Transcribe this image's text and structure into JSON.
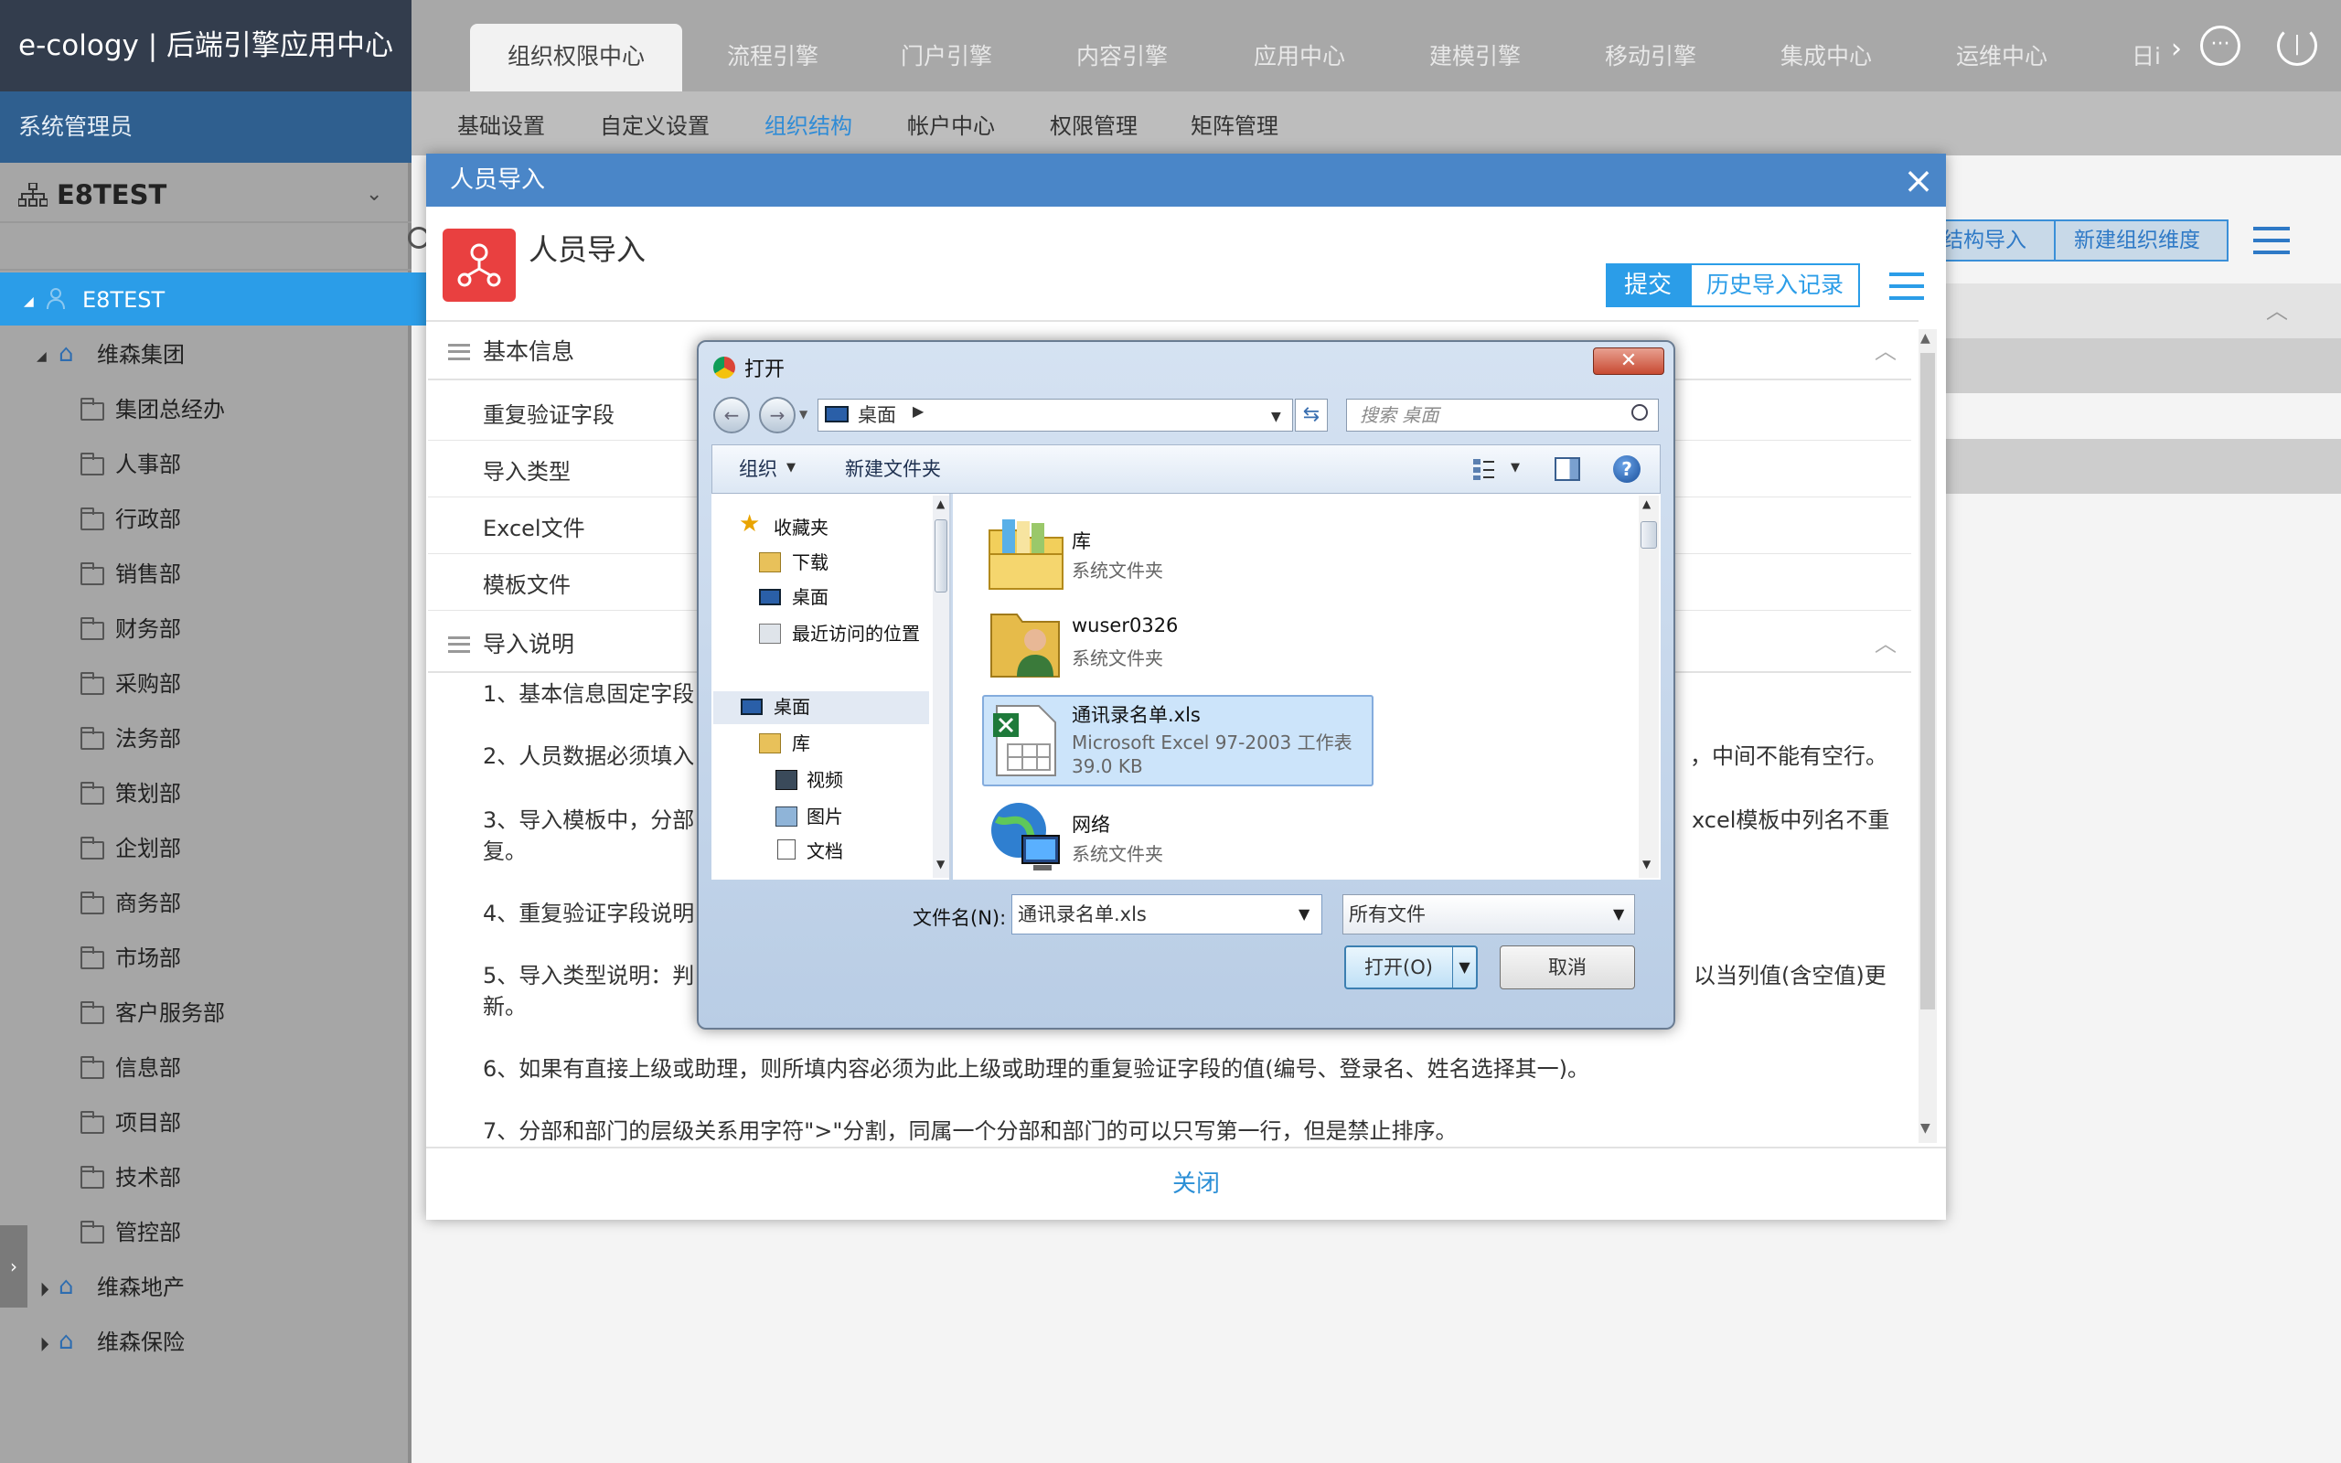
{
  "app": {
    "brand": "e-cology | 后端引擎应用中心"
  },
  "top_tabs": [
    "组织权限中心",
    "流程引擎",
    "门户引擎",
    "内容引擎",
    "应用中心",
    "建模引擎",
    "移动引擎",
    "集成中心",
    "运维中心",
    "日i"
  ],
  "sub_nav": [
    "基础设置",
    "自定义设置",
    "组织结构",
    "帐户中心",
    "权限管理",
    "矩阵管理"
  ],
  "sidebar": {
    "role": "系统管理员",
    "org": "E8TEST",
    "root": "E8TEST",
    "group": "维森集团",
    "departments": [
      "集团总经办",
      "人事部",
      "行政部",
      "销售部",
      "财务部",
      "采购部",
      "法务部",
      "策划部",
      "企划部",
      "商务部",
      "市场部",
      "客户服务部",
      "信息部",
      "项目部",
      "技术部",
      "管控部"
    ],
    "others": [
      "维森地产",
      "维森保险"
    ]
  },
  "background": {
    "btn1": "结构导入",
    "btn2": "新建组织维度"
  },
  "modal": {
    "title": "人员导入",
    "app_title": "人员导入",
    "submit": "提交",
    "history": "历史导入记录",
    "section_basic": "基本信息",
    "rows": [
      "重复验证字段",
      "导入类型",
      "Excel文件",
      "模板文件"
    ],
    "section_notes": "导入说明",
    "notes": [
      "1、基本信息固定字段",
      "2、人员数据必须填入",
      "，中间不能有空行。",
      "3、导入模板中，分部",
      "xcel模板中列名不重",
      "复。",
      "4、重复验证字段说明",
      "5、导入类型说明：判",
      "以当列值(含空值)更",
      "新。",
      "6、如果有直接上级或助理，则所填内容必须为此上级或助理的重复验证字段的值(编号、登录名、姓名选择其一)。",
      "7、分部和部门的层级关系用字符\">\"分割，同属一个分部和部门的可以只写第一行，但是禁止排序。"
    ],
    "close": "关闭"
  },
  "file_dialog": {
    "title": "打开",
    "address": "桌面",
    "search_placeholder": "搜索 桌面",
    "toolbar": {
      "organize": "组织",
      "new_folder": "新建文件夹"
    },
    "nav": {
      "favorites": "收藏夹",
      "downloads": "下载",
      "desktop": "桌面",
      "recent": "最近访问的位置",
      "desktop2": "桌面",
      "library": "库",
      "videos": "视频",
      "pictures": "图片",
      "docs": "文档"
    },
    "files": [
      {
        "name": "库",
        "sub": "系统文件夹"
      },
      {
        "name": "wuser0326",
        "sub": "系统文件夹"
      },
      {
        "name": "通讯录名单.xls",
        "sub": "Microsoft Excel 97-2003 工作表",
        "size": "39.0 KB"
      },
      {
        "name": "网络",
        "sub": "系统文件夹"
      }
    ],
    "filename_label": "文件名(N):",
    "filename_value": "通讯录名单.xls",
    "filetype": "所有文件",
    "open": "打开(O)",
    "cancel": "取消"
  },
  "colors": {
    "accent": "#2b9de8",
    "title_bar": "#4a86c8",
    "sidebar_head": "#2f5f8f",
    "danger": "#e94040"
  }
}
